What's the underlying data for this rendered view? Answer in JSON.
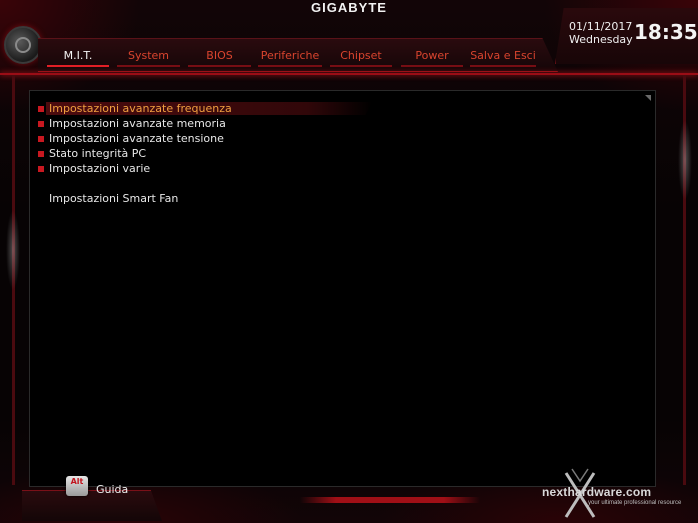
{
  "brand": "GIGABYTE",
  "tabs": [
    {
      "label": "M.I.T.",
      "active": true
    },
    {
      "label": "System",
      "active": false
    },
    {
      "label": "BIOS",
      "active": false
    },
    {
      "label": "Periferiche",
      "active": false
    },
    {
      "label": "Chipset",
      "active": false
    },
    {
      "label": "Power",
      "active": false
    },
    {
      "label": "Salva e Esci",
      "active": false
    }
  ],
  "clock": {
    "date": "01/11/2017",
    "weekday": "Wednesday",
    "time": "18:35"
  },
  "menu": {
    "items": [
      {
        "label": "Impostazioni avanzate frequenza",
        "selected": true
      },
      {
        "label": "Impostazioni avanzate memoria",
        "selected": false
      },
      {
        "label": "Impostazioni avanzate tensione",
        "selected": false
      },
      {
        "label": "Stato integrità PC",
        "selected": false
      },
      {
        "label": "Impostazioni varie",
        "selected": false
      }
    ],
    "extra_item": "Impostazioni Smart Fan"
  },
  "footer": {
    "key_label": "Alt",
    "help_label": "Guida"
  },
  "watermark": {
    "text": "nexthardware.com",
    "tagline": "your ultimate professional resource"
  },
  "colors": {
    "accent": "#c2141e",
    "selected_text": "#f0a040",
    "inactive_tab": "#d9442e"
  },
  "icons": {
    "logo": "gigabyte-emblem-icon",
    "bullet": "square-bullet-icon"
  }
}
